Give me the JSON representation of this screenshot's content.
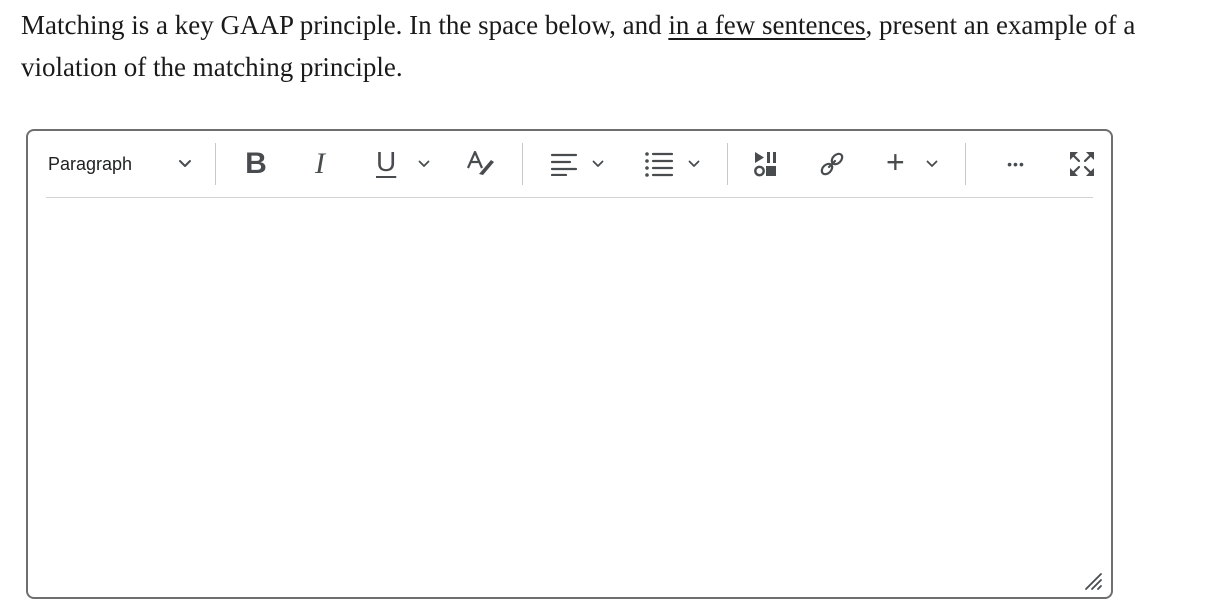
{
  "question": {
    "text_before": "Matching is a key GAAP principle. In the space below, and ",
    "underlined": "in a few sentences",
    "text_after": ", present an example of a violation of the matching principle."
  },
  "toolbar": {
    "format_select": "Paragraph",
    "bold_label": "B",
    "italic_label": "I",
    "underline_label": "U",
    "insert_label": "+",
    "more_label": "•••",
    "icons": [
      "chevron-down-icon",
      "bold-icon",
      "italic-icon",
      "underline-icon",
      "text-color-icon",
      "align-icon",
      "list-icon",
      "media-icon",
      "link-icon",
      "insert-icon",
      "more-icon",
      "fullscreen-icon",
      "resize-grip-icon"
    ]
  },
  "editor": {
    "content": ""
  }
}
